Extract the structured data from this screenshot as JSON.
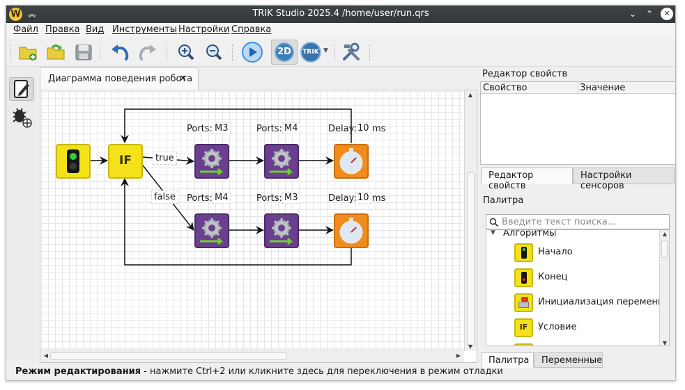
{
  "window": {
    "title": "TRIK Studio 2025.4 /home/user/run.qrs",
    "logo_letter": "W"
  },
  "menu": [
    "Файл",
    "Правка",
    "Вид",
    "Инструменты",
    "Настройки",
    "Справка"
  ],
  "toolbar": {
    "icons": [
      "new-project-icon",
      "open-project-icon",
      "save-icon",
      "undo-icon",
      "redo-icon",
      "zoom-in-icon",
      "zoom-out-icon",
      "run-icon",
      "2d-model-icon",
      "trik-robot-icon",
      "settings-tools-icon"
    ],
    "mode_2d_label": "2D",
    "robot_label": "TRIK"
  },
  "left_panel": {
    "icons": [
      "edit-mode-icon",
      "debug-mode-icon"
    ]
  },
  "document_tab": {
    "label": "Диаграмма поведения робота",
    "close_label": "✕"
  },
  "diagram": {
    "if_label": "IF",
    "edge_true": "true",
    "edge_false": "false",
    "ports_label": "Ports:",
    "delay_label": "Delay:",
    "row1": {
      "motor1_ports": "M3",
      "motor2_ports": "M4",
      "delay_value": "10",
      "delay_unit": "ms"
    },
    "row2": {
      "motor1_ports": "M4",
      "motor2_ports": "M3",
      "delay_value": "10",
      "delay_unit": "ms"
    }
  },
  "status_bar": {
    "bold": "Режим редактирования",
    "text": " - нажмите Ctrl+2 или кликните здесь для переключения в режим отладки"
  },
  "properties": {
    "title": "Редактор свойств",
    "col_property": "Свойство",
    "col_value": "Значение",
    "tabs": [
      "Редактор свойств",
      "Настройки сенсоров"
    ]
  },
  "palette": {
    "title": "Палитра",
    "search_placeholder": "Введите текст поиска...",
    "group": "Алгоритмы",
    "items": [
      "Начало",
      "Конец",
      "Инициализация переменной",
      "Условие"
    ],
    "tabs": [
      "Палитра",
      "Переменные"
    ]
  },
  "colors": {
    "titlebar": "#34383b",
    "block_yellow": "#f3e21a",
    "block_purple": "#6b3f8f",
    "block_orange": "#f08c1e",
    "run_blue": "#3d8ee0"
  }
}
